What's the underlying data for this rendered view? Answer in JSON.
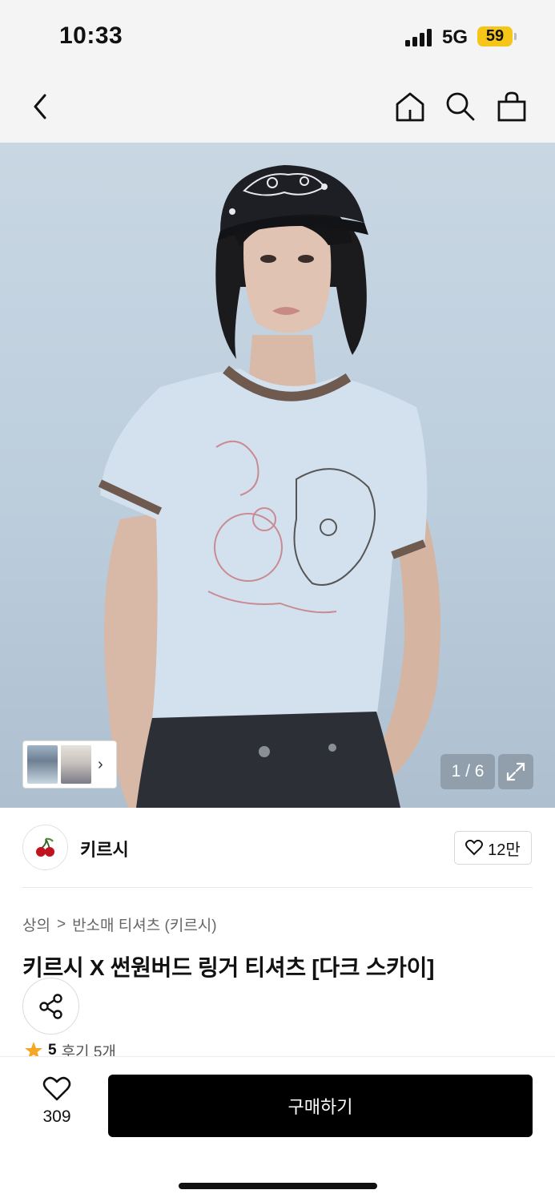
{
  "status_bar": {
    "time": "10:33",
    "network": "5G",
    "battery": "59"
  },
  "header": {
    "back_icon": "chevron-left-icon",
    "home_icon": "home-icon",
    "search_icon": "search-icon",
    "cart_icon": "shopping-bag-icon"
  },
  "gallery": {
    "counter": "1 / 6",
    "expand_icon": "expand-icon",
    "thumbs_arrow": "›"
  },
  "brand": {
    "name": "키르시",
    "logo_icon": "cherry-icon",
    "likes": "12만"
  },
  "product": {
    "breadcrumb": [
      "상의",
      "반소매 티셔츠 (키르시)"
    ],
    "breadcrumb_separator": ">",
    "title": "키르시 X 썬원버드 링거 티셔츠 [다크 스카이]",
    "rating": "5",
    "reviews": "후기 5개"
  },
  "bottom_bar": {
    "wish_count": "309",
    "buy_label": "구매하기"
  },
  "colors": {
    "accent": "#000000",
    "star": "#f5a623",
    "battery": "#f5c518"
  }
}
